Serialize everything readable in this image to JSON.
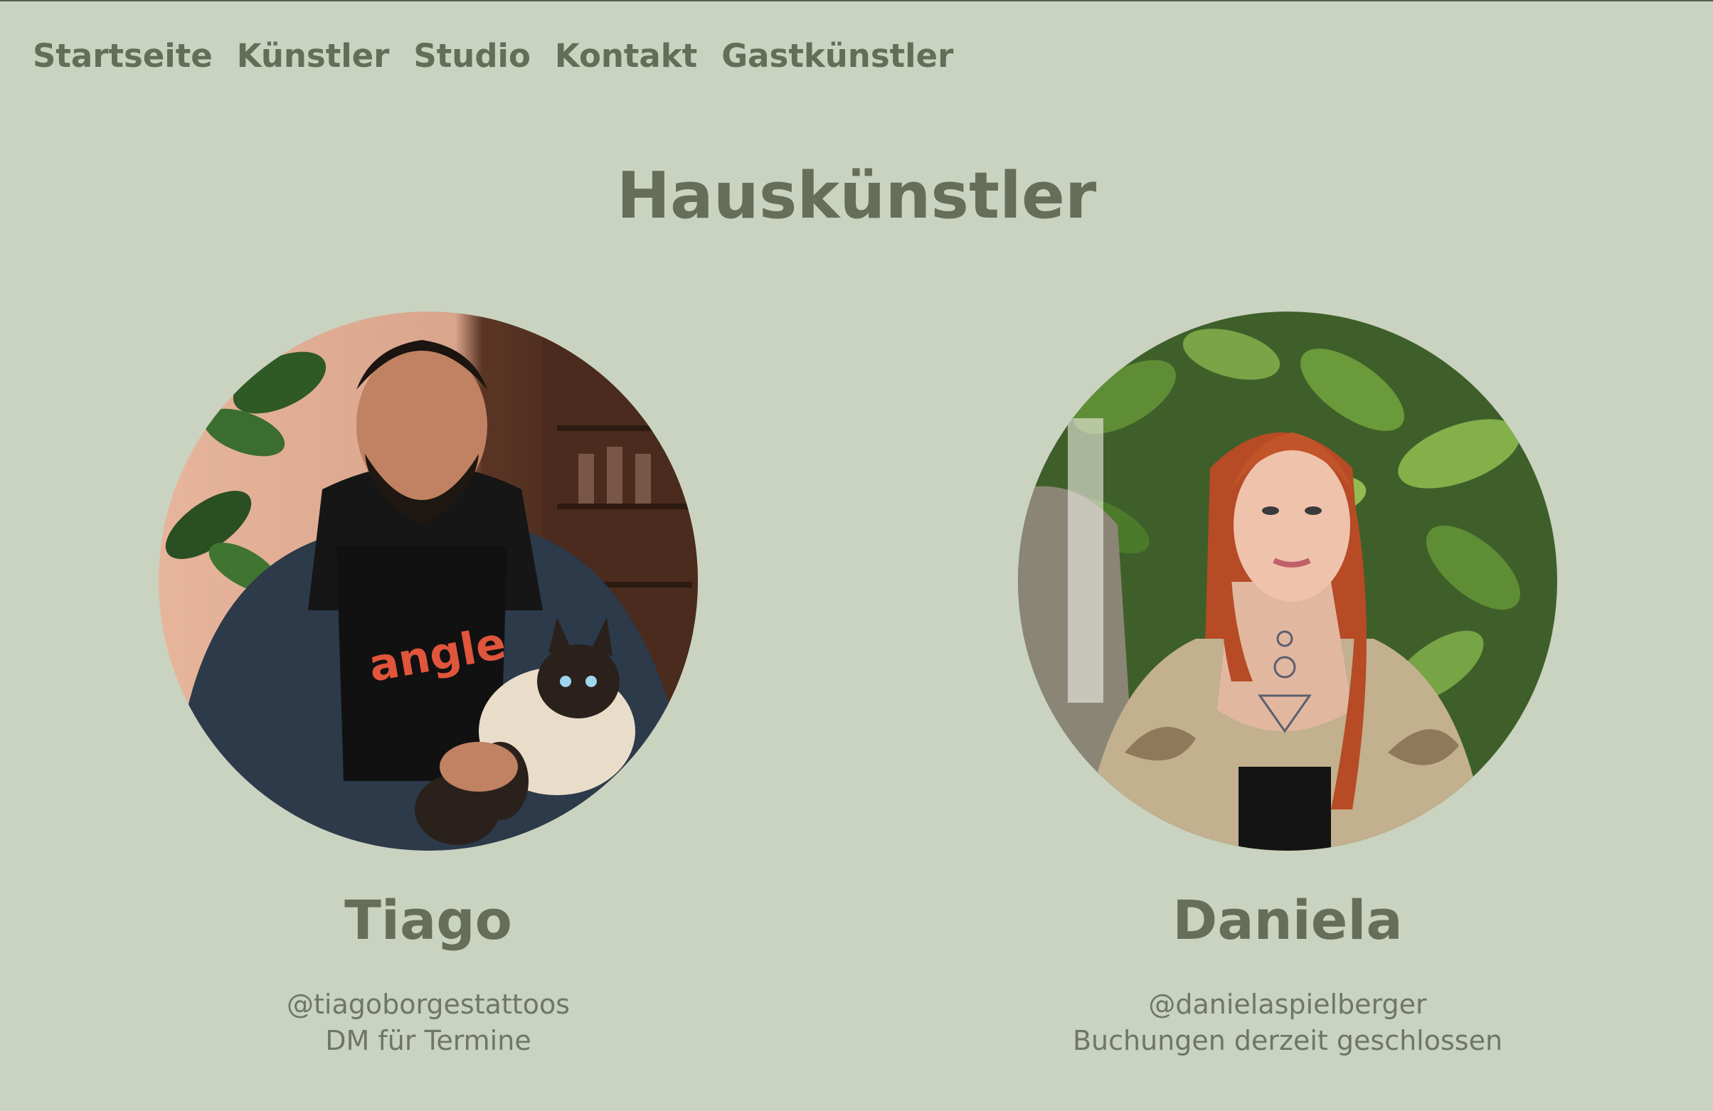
{
  "nav": {
    "items": [
      "Startseite",
      "Künstler",
      "Studio",
      "Kontakt",
      "Gastkünstler"
    ]
  },
  "page": {
    "title": "Hauskünstler"
  },
  "artists": [
    {
      "name": "Tiago",
      "handle": "@tiagoborgestattoos",
      "note": "DM für Termine",
      "photo_icon": "portrait-photo-man-with-cat"
    },
    {
      "name": "Daniela",
      "handle": "@danielaspielberger",
      "note": "Buchungen derzeit geschlossen",
      "photo_icon": "portrait-photo-woman-with-plants"
    }
  ],
  "colors": {
    "background": "#c9d3c0",
    "text": "#666e57",
    "muted_text": "#6f7666"
  }
}
